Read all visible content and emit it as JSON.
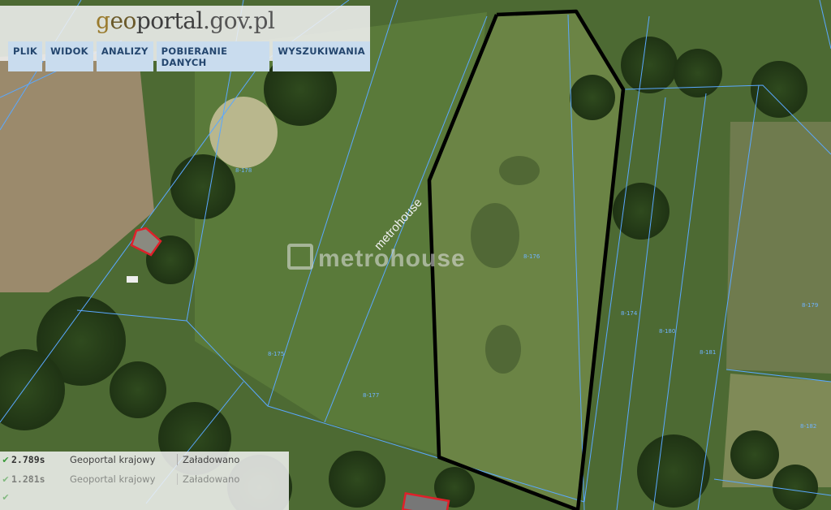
{
  "logo": {
    "text_g": "g",
    "text_eo": "eo",
    "text_portal": "portal",
    "text_dom": ".gov.pl"
  },
  "menu": {
    "items": [
      "PLIK",
      "WIDOK",
      "ANALIZY",
      "POBIERANIE DANYCH",
      "WYSZUKIWANIA"
    ]
  },
  "watermark": {
    "brand": "metrohouse",
    "diagonal": "metrohouse"
  },
  "parcels": [
    "8-178",
    "8-176",
    "8-177",
    "8-175",
    "8-174",
    "8-181",
    "8-180",
    "8-179",
    "8-182"
  ],
  "status": {
    "rows": [
      {
        "check": "✔",
        "time": "2.789s",
        "source": "Geoportal krajowy",
        "state": "Załadowano"
      },
      {
        "check": "✔",
        "time": "1.281s",
        "source": "Geoportal krajowy",
        "state": "Załadowano"
      },
      {
        "check": "✔",
        "time": "",
        "source": "",
        "state": ""
      }
    ]
  },
  "colors": {
    "parcel_line": "#5aa8ff",
    "boundary": "#000000",
    "building": "#e0202a"
  }
}
